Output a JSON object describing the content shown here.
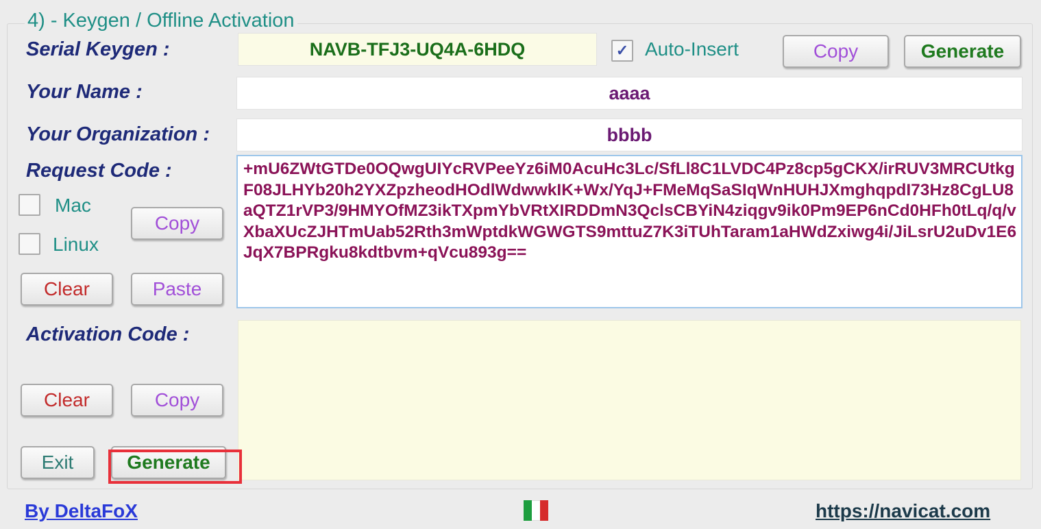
{
  "group": {
    "title": "4) - Keygen / Offline Activation"
  },
  "serial": {
    "label": "Serial Keygen :",
    "value": "NAVB-TFJ3-UQ4A-6HDQ",
    "auto_insert_label": "Auto-Insert",
    "auto_insert_checked": true,
    "copy_label": "Copy",
    "generate_label": "Generate"
  },
  "name": {
    "label": "Your Name :",
    "value": "aaaa"
  },
  "organization": {
    "label": "Your Organization :",
    "value": "bbbb"
  },
  "request": {
    "label": "Request Code :",
    "mac_label": "Mac",
    "linux_label": "Linux",
    "mac_checked": false,
    "linux_checked": false,
    "copy_label": "Copy",
    "clear_label": "Clear",
    "paste_label": "Paste",
    "value": "+mU6ZWtGTDe0OQwgUIYcRVPeeYz6iM0AcuHc3Lc/SfLl8C1LVDC4Pz8cp5gCKX/irRUV3MRCUtkgF08JLHYb20h2YXZpzheodHOdlWdwwkIK+Wx/YqJ+FMeMqSaSIqWnHUHJXmghqpdI73Hz8CgLU8aQTZ1rVP3/9HMYOfMZ3ikTXpmYbVRtXIRDDmN3QclsCBYiN4ziqgv9ik0Pm9EP6nCd0HFh0tLq/q/vXbaXUcZJHTmUab52Rth3mWptdkWGWGTS9mttuZ7K3iTUhTaram1aHWdZxiwg4i/JiLsrU2uDv1E6JqX7BPRgku8kdtbvm+qVcu893g=="
  },
  "activation": {
    "label": "Activation Code :",
    "value": "",
    "clear_label": "Clear",
    "copy_label": "Copy",
    "exit_label": "Exit",
    "generate_label": "Generate"
  },
  "footer": {
    "author": "By DeltaFoX",
    "url": "https://navicat.com",
    "flag_icon": "italy-flag-icon",
    "flag_colors": [
      "#1e9e3f",
      "#ffffff",
      "#d62b2b"
    ]
  },
  "colors": {
    "label": "#1e2a78",
    "accent_teal": "#1f8f86",
    "request_text": "#8a1257",
    "highlight": "#e8303a"
  }
}
